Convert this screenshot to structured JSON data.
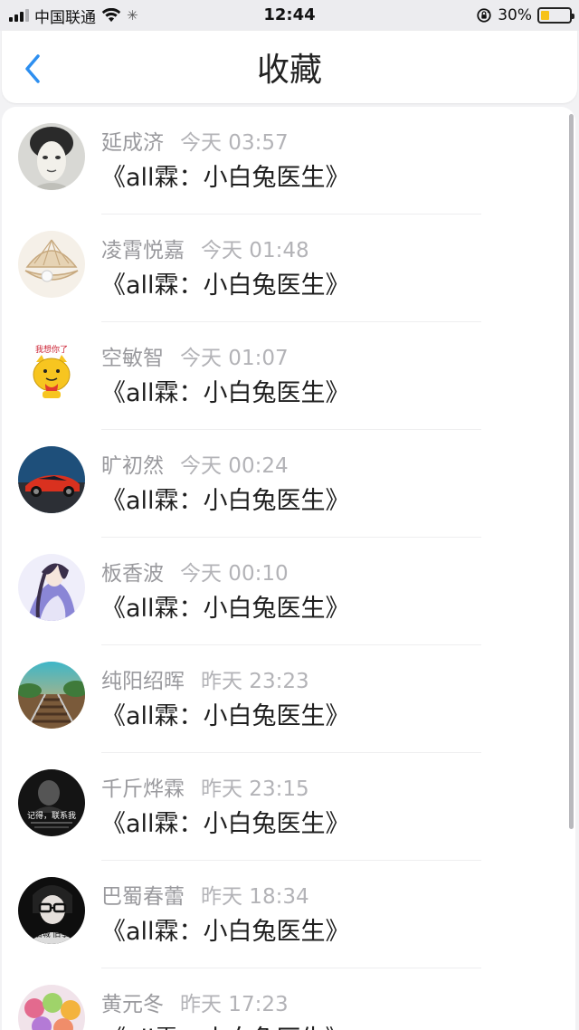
{
  "status_bar": {
    "carrier": "中国联通",
    "time": "12:44",
    "battery_percent": "30%",
    "battery_level": 0.3,
    "battery_color": "#f6c21a"
  },
  "header": {
    "title": "收藏",
    "back_icon": "chevron-left-icon",
    "accent_color": "#2d8ff0"
  },
  "favorites": [
    {
      "name": "延成济",
      "time": "今天 03:57",
      "title": "《all霖：小白兔医生》"
    },
    {
      "name": "凌霄悦嘉",
      "time": "今天 01:48",
      "title": "《all霖：小白兔医生》"
    },
    {
      "name": "空敏智",
      "time": "今天 01:07",
      "title": "《all霖：小白兔医生》",
      "avatar_text": "我想你了"
    },
    {
      "name": "旷初然",
      "time": "今天 00:24",
      "title": "《all霖：小白兔医生》"
    },
    {
      "name": "板香波",
      "time": "今天 00:10",
      "title": "《all霖：小白兔医生》"
    },
    {
      "name": "纯阳绍晖",
      "time": "昨天 23:23",
      "title": "《all霖：小白兔医生》"
    },
    {
      "name": "千斤烨霖",
      "time": "昨天 23:15",
      "title": "《all霖：小白兔医生》",
      "avatar_text": "记得，联系我"
    },
    {
      "name": "巴蜀春蕾",
      "time": "昨天 18:34",
      "title": "《all霖：小白兔医生》",
      "avatar_text": "旧城 旧事"
    },
    {
      "name": "黄元冬",
      "time": "昨天 17:23",
      "title": "《all霖：小白兔医生》"
    }
  ]
}
